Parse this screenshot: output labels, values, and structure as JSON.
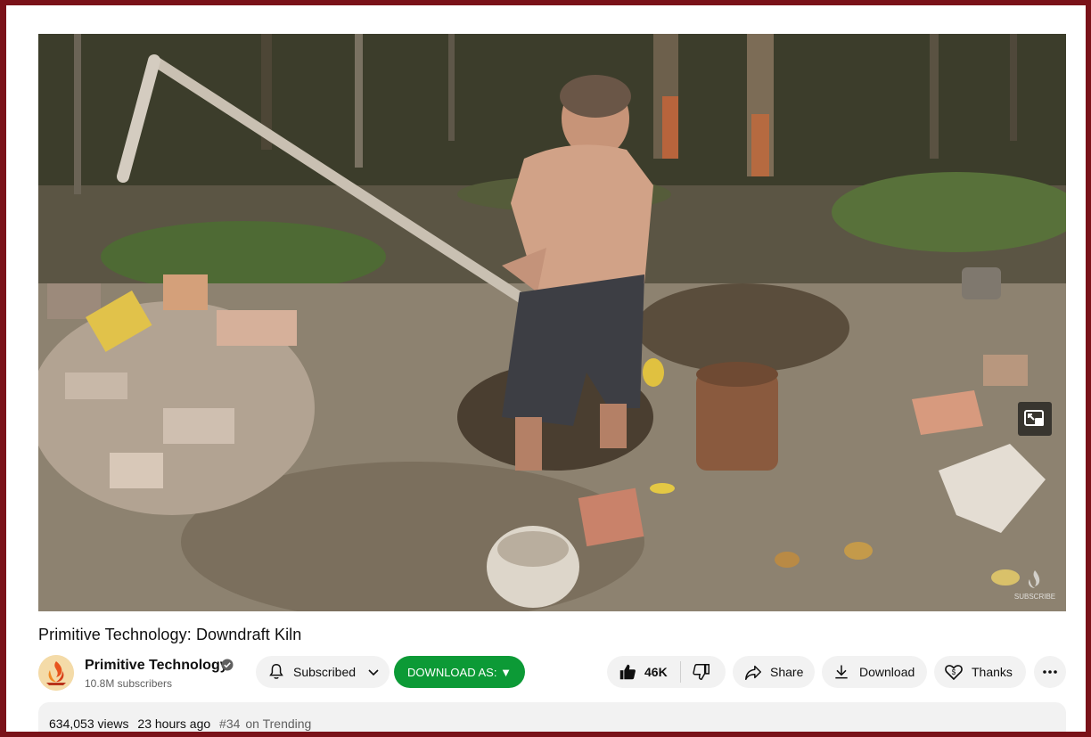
{
  "video": {
    "title": "Primitive Technology: Downdraft Kiln",
    "pip_icon": "miniplayer-icon",
    "watermark_icon": "subscribe-watermark-icon",
    "watermark_text": "SUBSCRIBE"
  },
  "channel": {
    "name": "Primitive Technology",
    "subscribers": "10.8M subscribers",
    "verified_icon": "verified-check-icon",
    "avatar_icon": "fire-logo-icon"
  },
  "actions": {
    "subscribed_label": "Subscribed",
    "download_as_label": "DOWNLOAD AS: ▼",
    "likes": "46K",
    "share_label": "Share",
    "download_label": "Download",
    "thanks_label": "Thanks",
    "accent_green": "#0c9a36"
  },
  "stats": {
    "views": "634,053 views",
    "posted": "23 hours ago",
    "trending_rank": "#34",
    "trending_label": "on Trending"
  }
}
